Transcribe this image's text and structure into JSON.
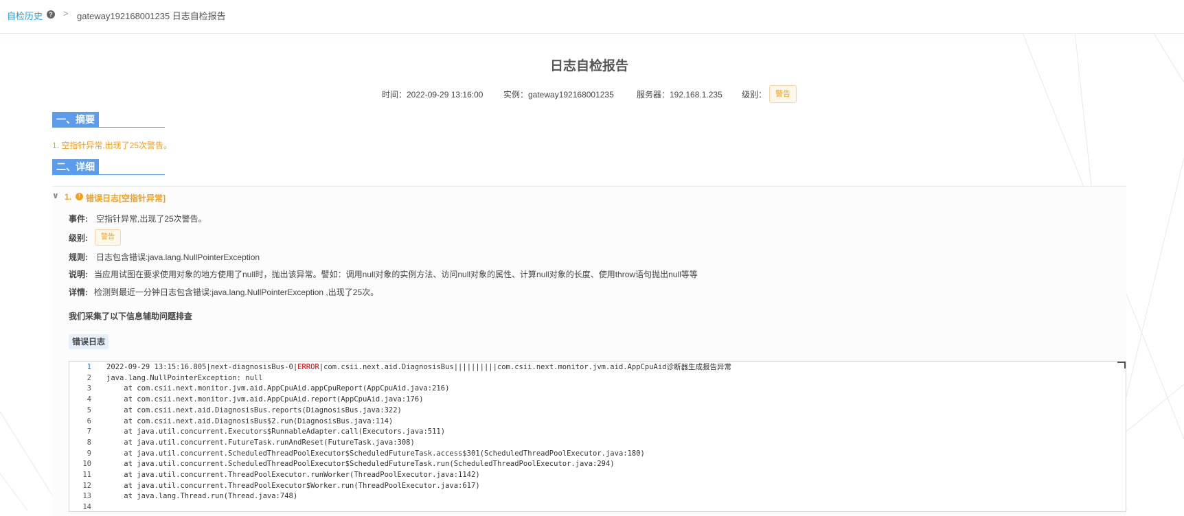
{
  "breadcrumb": {
    "root": "自检历史",
    "help_icon": "?",
    "separator": ">",
    "current": "gateway192168001235 日志自检报告"
  },
  "report": {
    "title": "日志自检报告",
    "time": "时间：2022-09-29 13:16:00",
    "instance": "实例：gateway192168001235",
    "server": "服务器：192.168.1.235",
    "level_label": "级别：",
    "level_tag": "警告"
  },
  "sections": {
    "summary_heading": "一、摘要",
    "summary_item": "1. 空指针异常,出现了25次警告。",
    "detail_heading": "二、详细"
  },
  "detail": {
    "collapse_chevron": "∨",
    "index": "1.",
    "warn_icon": "!",
    "title": "错误日志[空指针异常]",
    "event_label": "事件:",
    "event_value": "空指针异常,出现了25次警告。",
    "level_label": "级别:",
    "level_tag": "警告",
    "rule_label": "规则:",
    "rule_value": "日志包含错误:java.lang.NullPointerException",
    "desc_label": "说明:",
    "desc_value": "当应用试图在要求使用对象的地方使用了null时，抛出该异常。譬如：调用null对象的实例方法、访问null对象的属性、计算null对象的长度、使用throw语句抛出null等等",
    "info_label": "详情:",
    "info_value": "检测到最近一分钟日志包含错误:java.lang.NullPointerException ,出现了25次。",
    "collect_note": "我们采集了以下信息辅助问题排查",
    "log_tab": "错误日志"
  },
  "log_lines": [
    {
      "n": "1",
      "pre": "2022-09-29 13:15:16.805|next-diagnosisBus-0|",
      "err": "ERROR",
      "post": "|com.csii.next.aid.DiagnosisBus||||||||||com.csii.next.monitor.jvm.aid.AppCpuAid诊断器生成报告异常"
    },
    {
      "n": "2",
      "pre": "java.lang.NullPointerException: null",
      "err": "",
      "post": ""
    },
    {
      "n": "3",
      "pre": "    at com.csii.next.monitor.jvm.aid.AppCpuAid.appCpuReport(AppCpuAid.java:216)",
      "err": "",
      "post": ""
    },
    {
      "n": "4",
      "pre": "    at com.csii.next.monitor.jvm.aid.AppCpuAid.report(AppCpuAid.java:176)",
      "err": "",
      "post": ""
    },
    {
      "n": "5",
      "pre": "    at com.csii.next.aid.DiagnosisBus.reports(DiagnosisBus.java:322)",
      "err": "",
      "post": ""
    },
    {
      "n": "6",
      "pre": "    at com.csii.next.aid.DiagnosisBus$2.run(DiagnosisBus.java:114)",
      "err": "",
      "post": ""
    },
    {
      "n": "7",
      "pre": "    at java.util.concurrent.Executors$RunnableAdapter.call(Executors.java:511)",
      "err": "",
      "post": ""
    },
    {
      "n": "8",
      "pre": "    at java.util.concurrent.FutureTask.runAndReset(FutureTask.java:308)",
      "err": "",
      "post": ""
    },
    {
      "n": "9",
      "pre": "    at java.util.concurrent.ScheduledThreadPoolExecutor$ScheduledFutureTask.access$301(ScheduledThreadPoolExecutor.java:180)",
      "err": "",
      "post": ""
    },
    {
      "n": "10",
      "pre": "    at java.util.concurrent.ScheduledThreadPoolExecutor$ScheduledFutureTask.run(ScheduledThreadPoolExecutor.java:294)",
      "err": "",
      "post": ""
    },
    {
      "n": "11",
      "pre": "    at java.util.concurrent.ThreadPoolExecutor.runWorker(ThreadPoolExecutor.java:1142)",
      "err": "",
      "post": ""
    },
    {
      "n": "12",
      "pre": "    at java.util.concurrent.ThreadPoolExecutor$Worker.run(ThreadPoolExecutor.java:617)",
      "err": "",
      "post": ""
    },
    {
      "n": "13",
      "pre": "    at java.lang.Thread.run(Thread.java:748)",
      "err": "",
      "post": ""
    },
    {
      "n": "14",
      "pre": "",
      "err": "",
      "post": ""
    }
  ],
  "colors": {
    "link": "#1e9fe8",
    "warning": "#f0a020",
    "section_blue": "#5b9dec",
    "error_red": "#cc0000",
    "active_line_number": "#1e70e8"
  }
}
